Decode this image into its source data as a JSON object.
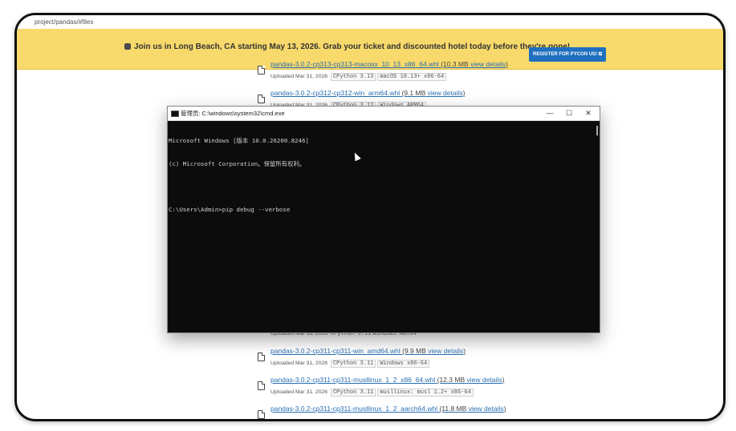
{
  "browser": {
    "url_fragment": "project/pandas/#files"
  },
  "banner": {
    "text": "Join us in Long Beach, CA starting May 13, 2026. Grab your ticket and discounted hotel today before they're gone!",
    "button_label": "REGISTER FOR PYCON US! ⧉",
    "bg_color": "#f8d96b",
    "button_color": "#1f6fbf"
  },
  "files": [
    {
      "name": "pandas-3.0.2-cp313-cp313-macosx_10_13_x86_64.whl",
      "size": "(10.3 MB",
      "details": "view details",
      "close": ")",
      "uploaded": "Uploaded Mar 31, 2026",
      "tags": [
        "CPython 3.13",
        "macOS 10.13+ x86-64"
      ]
    },
    {
      "name": "pandas-3.0.2-cp312-cp312-win_arm64.whl",
      "size": "(9.1 MB",
      "details": "view details",
      "close": ")",
      "uploaded": "Uploaded Mar 31, 2026",
      "tags": [
        "CPython 3.12",
        "Windows ARM64"
      ]
    },
    {
      "name": "",
      "size": "",
      "details": "",
      "close": "",
      "uploaded": "Uploaded Mar 31, 2026",
      "tags": [
        "CPython 3.11",
        "Windows ARM64"
      ]
    },
    {
      "name": "pandas-3.0.2-cp311-cp311-win_amd64.whl",
      "size": "(9.9 MB",
      "details": "view details",
      "close": ")",
      "uploaded": "Uploaded Mar 31, 2026",
      "tags": [
        "CPython 3.11",
        "Windows x86-64"
      ]
    },
    {
      "name": "pandas-3.0.2-cp311-cp311-musllinux_1_2_x86_64.whl",
      "size": "(12.3 MB",
      "details": "view details",
      "close": ")",
      "uploaded": "Uploaded Mar 31, 2026",
      "tags": [
        "CPython 3.11",
        "musllinux: musl 1.2+ x86-64"
      ]
    },
    {
      "name": "pandas-3.0.2-cp311-cp311-musllinux_1_2_aarch64.whl",
      "size": "(11.8 MB",
      "details": "view details",
      "close": ")",
      "uploaded": "",
      "tags": []
    }
  ],
  "cmd": {
    "title": "管理员: C:\\windows\\system32\\cmd.exe",
    "minimize": "—",
    "maximize": "☐",
    "close": "✕",
    "lines": [
      "Microsoft Windows [版本 10.0.26200.8246]",
      "(c) Microsoft Corporation。保留所有权利。",
      "",
      "C:\\Users\\Admin>pip debug --verbose"
    ]
  }
}
